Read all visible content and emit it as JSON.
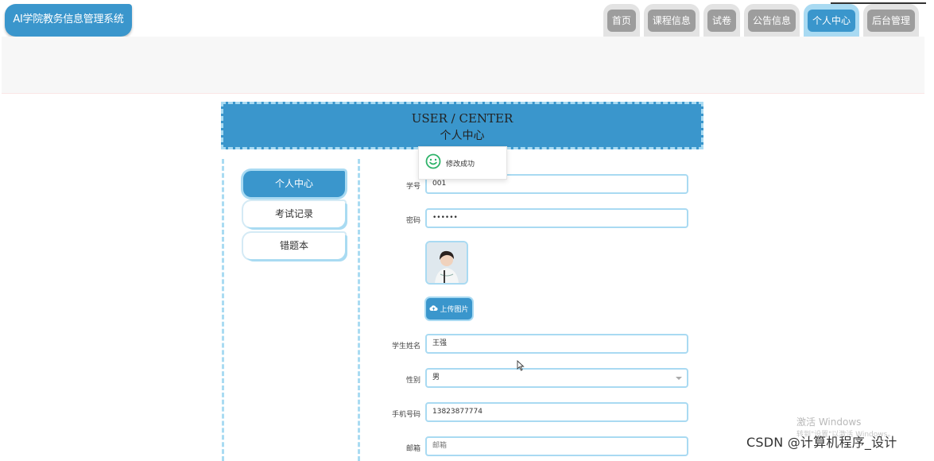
{
  "app": {
    "title": "AI学院教务信息管理系统"
  },
  "nav": {
    "items": [
      {
        "label": "首页",
        "active": false
      },
      {
        "label": "课程信息",
        "active": false
      },
      {
        "label": "试卷",
        "active": false
      },
      {
        "label": "公告信息",
        "active": false
      },
      {
        "label": "个人中心",
        "active": true
      },
      {
        "label": "后台管理",
        "active": false
      }
    ]
  },
  "banner": {
    "title_en": "USER / CENTER",
    "title_cn": "个人中心"
  },
  "sidebar": {
    "items": [
      {
        "label": "个人中心",
        "active": true
      },
      {
        "label": "考试记录",
        "active": false
      },
      {
        "label": "错题本",
        "active": false
      }
    ]
  },
  "toast": {
    "icon": "smile-icon",
    "message": "修改成功"
  },
  "form": {
    "student_id": {
      "label": "学号",
      "value": "001"
    },
    "password": {
      "label": "密码",
      "value": "••••••"
    },
    "upload_button": {
      "icon": "cloud-upload-icon",
      "label": "上传图片"
    },
    "student_name": {
      "label": "学生姓名",
      "value": "王强"
    },
    "gender": {
      "label": "性别",
      "value": "男"
    },
    "phone": {
      "label": "手机号码",
      "value": "13823877774"
    },
    "email": {
      "label": "邮箱",
      "value": "",
      "placeholder": "邮箱"
    }
  },
  "overlay": {
    "activate_windows": "激活 Windows",
    "activate_hint": "转到\"设置\"以激活 Windows。",
    "csdn_watermark": "CSDN @计算机程序_设计"
  },
  "colors": {
    "primary": "#3a96cc",
    "accent_light": "#a9daf2",
    "nav_inactive": "#9d9d9d"
  }
}
